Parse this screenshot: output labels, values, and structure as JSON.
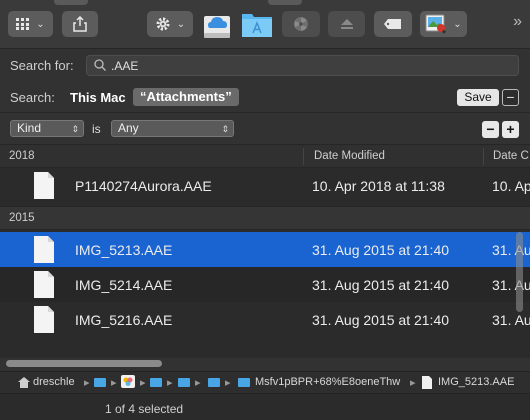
{
  "toolbar": {
    "view_icon": "grid-view-icon",
    "share_icon": "share-icon",
    "action_icon": "gear-icon",
    "drive_icon": "icloud-drive-icon",
    "folder_icon": "applications-folder-icon",
    "burn_icon": "burn-icon",
    "eject_icon": "eject-icon",
    "tag_icon": "tag-icon",
    "app_icon": "preview-app-icon",
    "more_icon": "chevron-double-right-icon",
    "more_glyph": "»"
  },
  "search": {
    "label": "Search for:",
    "value": ".AAE"
  },
  "scope": {
    "label": "Search:",
    "this_mac": "This Mac",
    "current": "“Attachments”",
    "save": "Save",
    "remove": "−"
  },
  "criteria": {
    "attribute": "Kind",
    "operator": "is",
    "value": "Any",
    "remove": "−",
    "add": "+"
  },
  "table": {
    "headers": {
      "name": "2018",
      "date_modified": "Date Modified",
      "date_other": "Date C"
    },
    "groups": [
      {
        "label": "2018",
        "rows": [
          {
            "name": "P1140274Aurora.AAE",
            "date": "10. Apr 2018 at 11:38",
            "date2": "10. Ap"
          }
        ]
      },
      {
        "label": "2015",
        "rows": [
          {
            "name": "IMG_5213.AAE",
            "date": "31. Aug 2015 at 21:40",
            "date2": "31. Au",
            "selected": true
          },
          {
            "name": "IMG_5214.AAE",
            "date": "31. Aug 2015 at 21:40",
            "date2": "31. Au"
          },
          {
            "name": "IMG_5216.AAE",
            "date": "31. Aug 2015 at 21:40",
            "date2": "31. Au"
          }
        ]
      }
    ]
  },
  "pathbar": {
    "user": "dreschle",
    "folder_long": "Msfv1pBPR+68%E8oeneThw",
    "file": "IMG_5213.AAE",
    "separator": "▸"
  },
  "status": {
    "text": "1 of 4 selected"
  },
  "colors": {
    "selection": "#1a64d2",
    "folder_blue": "#48a6e6"
  }
}
